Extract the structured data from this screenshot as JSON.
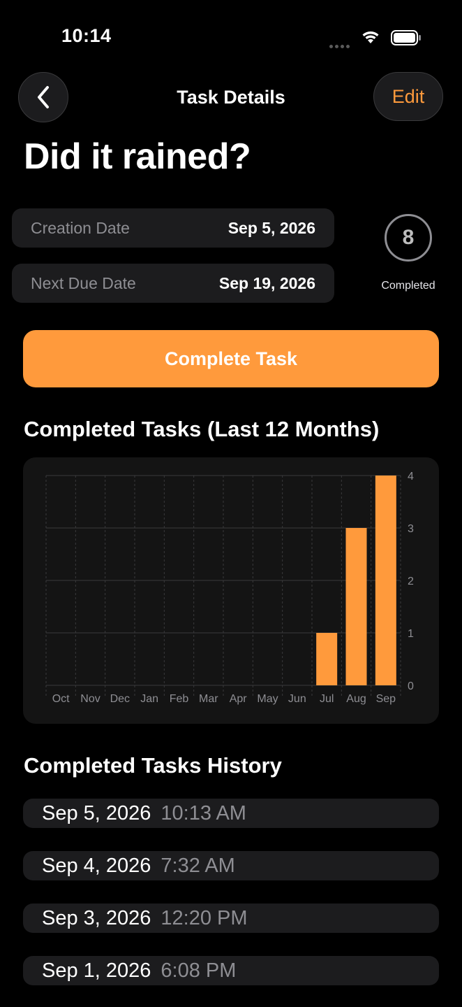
{
  "status_bar": {
    "time": "10:14"
  },
  "nav": {
    "title": "Task Details",
    "edit_label": "Edit"
  },
  "task": {
    "title": "Did it rained?"
  },
  "dates": [
    {
      "label": "Creation Date",
      "value": "Sep 5, 2026"
    },
    {
      "label": "Next Due Date",
      "value": "Sep 19, 2026"
    }
  ],
  "completed": {
    "count": "8",
    "label": "Completed"
  },
  "complete_button_label": "Complete Task",
  "chart_heading": "Completed Tasks (Last 12 Months)",
  "history_heading": "Completed Tasks History",
  "history": [
    {
      "date": "Sep 5, 2026",
      "time": "10:13 AM"
    },
    {
      "date": "Sep 4, 2026",
      "time": "7:32 AM"
    },
    {
      "date": "Sep 3, 2026",
      "time": "12:20 PM"
    },
    {
      "date": "Sep 1, 2026",
      "time": "6:08 PM"
    }
  ],
  "colors": {
    "accent": "#ff9a3c",
    "card": "#1c1c1e",
    "background": "#000000"
  },
  "chart_data": {
    "type": "bar",
    "categories": [
      "Oct",
      "Nov",
      "Dec",
      "Jan",
      "Feb",
      "Mar",
      "Apr",
      "May",
      "Jun",
      "Jul",
      "Aug",
      "Sep"
    ],
    "values": [
      0,
      0,
      0,
      0,
      0,
      0,
      0,
      0,
      0,
      1,
      3,
      4
    ],
    "yticks": [
      0,
      1,
      2,
      3,
      4
    ],
    "ylim": [
      0,
      4
    ],
    "yaxis_position": "right",
    "grid": true,
    "bar_color": "#ff9a3c"
  }
}
